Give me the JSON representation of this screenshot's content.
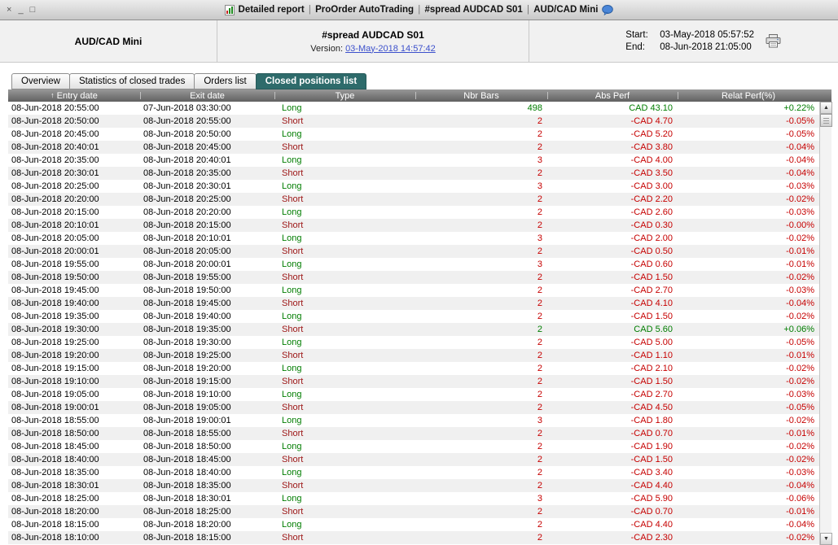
{
  "window": {
    "controls": {
      "close": "×",
      "minimize": "_",
      "maximize": "□"
    },
    "title_parts": [
      "Detailed report",
      "ProOrder AutoTrading",
      "#spread AUDCAD S01",
      "AUD/CAD Mini"
    ],
    "separator": "|"
  },
  "summary": {
    "instrument": "AUD/CAD Mini",
    "system": "#spread AUDCAD S01",
    "version_label": "Version:",
    "version": "03-May-2018 14:57:42",
    "start_label": "Start:",
    "start": "03-May-2018 05:57:52",
    "end_label": "End:",
    "end": "08-Jun-2018 21:05:00"
  },
  "tabs": [
    {
      "label": "Overview",
      "active": false
    },
    {
      "label": "Statistics of closed trades",
      "active": false
    },
    {
      "label": "Orders list",
      "active": false
    },
    {
      "label": "Closed positions list",
      "active": true
    }
  ],
  "table": {
    "sort_icon": "↑",
    "columns": [
      {
        "label": "Entry date",
        "sorted": true
      },
      {
        "label": "Exit date"
      },
      {
        "label": "Type"
      },
      {
        "label": "Nbr Bars"
      },
      {
        "label": "Abs Perf"
      },
      {
        "label": "Relat Perf(%)"
      }
    ],
    "rows": [
      {
        "entry": "08-Jun-2018 20:55:00",
        "exit": "07-Jun-2018 03:30:00",
        "type": "Long",
        "bars": "498",
        "abs": "CAD 43.10",
        "relat": "+0.22%"
      },
      {
        "entry": "08-Jun-2018 20:50:00",
        "exit": "08-Jun-2018 20:55:00",
        "type": "Short",
        "bars": "2",
        "abs": "-CAD 4.70",
        "relat": "-0.05%"
      },
      {
        "entry": "08-Jun-2018 20:45:00",
        "exit": "08-Jun-2018 20:50:00",
        "type": "Long",
        "bars": "2",
        "abs": "-CAD 5.20",
        "relat": "-0.05%"
      },
      {
        "entry": "08-Jun-2018 20:40:01",
        "exit": "08-Jun-2018 20:45:00",
        "type": "Short",
        "bars": "2",
        "abs": "-CAD 3.80",
        "relat": "-0.04%"
      },
      {
        "entry": "08-Jun-2018 20:35:00",
        "exit": "08-Jun-2018 20:40:01",
        "type": "Long",
        "bars": "3",
        "abs": "-CAD 4.00",
        "relat": "-0.04%"
      },
      {
        "entry": "08-Jun-2018 20:30:01",
        "exit": "08-Jun-2018 20:35:00",
        "type": "Short",
        "bars": "2",
        "abs": "-CAD 3.50",
        "relat": "-0.04%"
      },
      {
        "entry": "08-Jun-2018 20:25:00",
        "exit": "08-Jun-2018 20:30:01",
        "type": "Long",
        "bars": "3",
        "abs": "-CAD 3.00",
        "relat": "-0.03%"
      },
      {
        "entry": "08-Jun-2018 20:20:00",
        "exit": "08-Jun-2018 20:25:00",
        "type": "Short",
        "bars": "2",
        "abs": "-CAD 2.20",
        "relat": "-0.02%"
      },
      {
        "entry": "08-Jun-2018 20:15:00",
        "exit": "08-Jun-2018 20:20:00",
        "type": "Long",
        "bars": "2",
        "abs": "-CAD 2.60",
        "relat": "-0.03%"
      },
      {
        "entry": "08-Jun-2018 20:10:01",
        "exit": "08-Jun-2018 20:15:00",
        "type": "Short",
        "bars": "2",
        "abs": "-CAD 0.30",
        "relat": "-0.00%"
      },
      {
        "entry": "08-Jun-2018 20:05:00",
        "exit": "08-Jun-2018 20:10:01",
        "type": "Long",
        "bars": "3",
        "abs": "-CAD 2.00",
        "relat": "-0.02%"
      },
      {
        "entry": "08-Jun-2018 20:00:01",
        "exit": "08-Jun-2018 20:05:00",
        "type": "Short",
        "bars": "2",
        "abs": "-CAD 0.50",
        "relat": "-0.01%"
      },
      {
        "entry": "08-Jun-2018 19:55:00",
        "exit": "08-Jun-2018 20:00:01",
        "type": "Long",
        "bars": "3",
        "abs": "-CAD 0.60",
        "relat": "-0.01%"
      },
      {
        "entry": "08-Jun-2018 19:50:00",
        "exit": "08-Jun-2018 19:55:00",
        "type": "Short",
        "bars": "2",
        "abs": "-CAD 1.50",
        "relat": "-0.02%"
      },
      {
        "entry": "08-Jun-2018 19:45:00",
        "exit": "08-Jun-2018 19:50:00",
        "type": "Long",
        "bars": "2",
        "abs": "-CAD 2.70",
        "relat": "-0.03%"
      },
      {
        "entry": "08-Jun-2018 19:40:00",
        "exit": "08-Jun-2018 19:45:00",
        "type": "Short",
        "bars": "2",
        "abs": "-CAD 4.10",
        "relat": "-0.04%"
      },
      {
        "entry": "08-Jun-2018 19:35:00",
        "exit": "08-Jun-2018 19:40:00",
        "type": "Long",
        "bars": "2",
        "abs": "-CAD 1.50",
        "relat": "-0.02%"
      },
      {
        "entry": "08-Jun-2018 19:30:00",
        "exit": "08-Jun-2018 19:35:00",
        "type": "Short",
        "bars": "2",
        "abs": "CAD 5.60",
        "relat": "+0.06%"
      },
      {
        "entry": "08-Jun-2018 19:25:00",
        "exit": "08-Jun-2018 19:30:00",
        "type": "Long",
        "bars": "2",
        "abs": "-CAD 5.00",
        "relat": "-0.05%"
      },
      {
        "entry": "08-Jun-2018 19:20:00",
        "exit": "08-Jun-2018 19:25:00",
        "type": "Short",
        "bars": "2",
        "abs": "-CAD 1.10",
        "relat": "-0.01%"
      },
      {
        "entry": "08-Jun-2018 19:15:00",
        "exit": "08-Jun-2018 19:20:00",
        "type": "Long",
        "bars": "2",
        "abs": "-CAD 2.10",
        "relat": "-0.02%"
      },
      {
        "entry": "08-Jun-2018 19:10:00",
        "exit": "08-Jun-2018 19:15:00",
        "type": "Short",
        "bars": "2",
        "abs": "-CAD 1.50",
        "relat": "-0.02%"
      },
      {
        "entry": "08-Jun-2018 19:05:00",
        "exit": "08-Jun-2018 19:10:00",
        "type": "Long",
        "bars": "2",
        "abs": "-CAD 2.70",
        "relat": "-0.03%"
      },
      {
        "entry": "08-Jun-2018 19:00:01",
        "exit": "08-Jun-2018 19:05:00",
        "type": "Short",
        "bars": "2",
        "abs": "-CAD 4.50",
        "relat": "-0.05%"
      },
      {
        "entry": "08-Jun-2018 18:55:00",
        "exit": "08-Jun-2018 19:00:01",
        "type": "Long",
        "bars": "3",
        "abs": "-CAD 1.80",
        "relat": "-0.02%"
      },
      {
        "entry": "08-Jun-2018 18:50:00",
        "exit": "08-Jun-2018 18:55:00",
        "type": "Short",
        "bars": "2",
        "abs": "-CAD 0.70",
        "relat": "-0.01%"
      },
      {
        "entry": "08-Jun-2018 18:45:00",
        "exit": "08-Jun-2018 18:50:00",
        "type": "Long",
        "bars": "2",
        "abs": "-CAD 1.90",
        "relat": "-0.02%"
      },
      {
        "entry": "08-Jun-2018 18:40:00",
        "exit": "08-Jun-2018 18:45:00",
        "type": "Short",
        "bars": "2",
        "abs": "-CAD 1.50",
        "relat": "-0.02%"
      },
      {
        "entry": "08-Jun-2018 18:35:00",
        "exit": "08-Jun-2018 18:40:00",
        "type": "Long",
        "bars": "2",
        "abs": "-CAD 3.40",
        "relat": "-0.03%"
      },
      {
        "entry": "08-Jun-2018 18:30:01",
        "exit": "08-Jun-2018 18:35:00",
        "type": "Short",
        "bars": "2",
        "abs": "-CAD 4.40",
        "relat": "-0.04%"
      },
      {
        "entry": "08-Jun-2018 18:25:00",
        "exit": "08-Jun-2018 18:30:01",
        "type": "Long",
        "bars": "3",
        "abs": "-CAD 5.90",
        "relat": "-0.06%"
      },
      {
        "entry": "08-Jun-2018 18:20:00",
        "exit": "08-Jun-2018 18:25:00",
        "type": "Short",
        "bars": "2",
        "abs": "-CAD 0.70",
        "relat": "-0.01%"
      },
      {
        "entry": "08-Jun-2018 18:15:00",
        "exit": "08-Jun-2018 18:20:00",
        "type": "Long",
        "bars": "2",
        "abs": "-CAD 4.40",
        "relat": "-0.04%"
      },
      {
        "entry": "08-Jun-2018 18:10:00",
        "exit": "08-Jun-2018 18:15:00",
        "type": "Short",
        "bars": "2",
        "abs": "-CAD 2.30",
        "relat": "-0.02%"
      }
    ]
  },
  "colors": {
    "positive": "#007d00",
    "negative": "#c60000",
    "long": "#007d00",
    "short": "#9c1414",
    "active_tab": "#2e6b6b",
    "link": "#3c50cc"
  }
}
